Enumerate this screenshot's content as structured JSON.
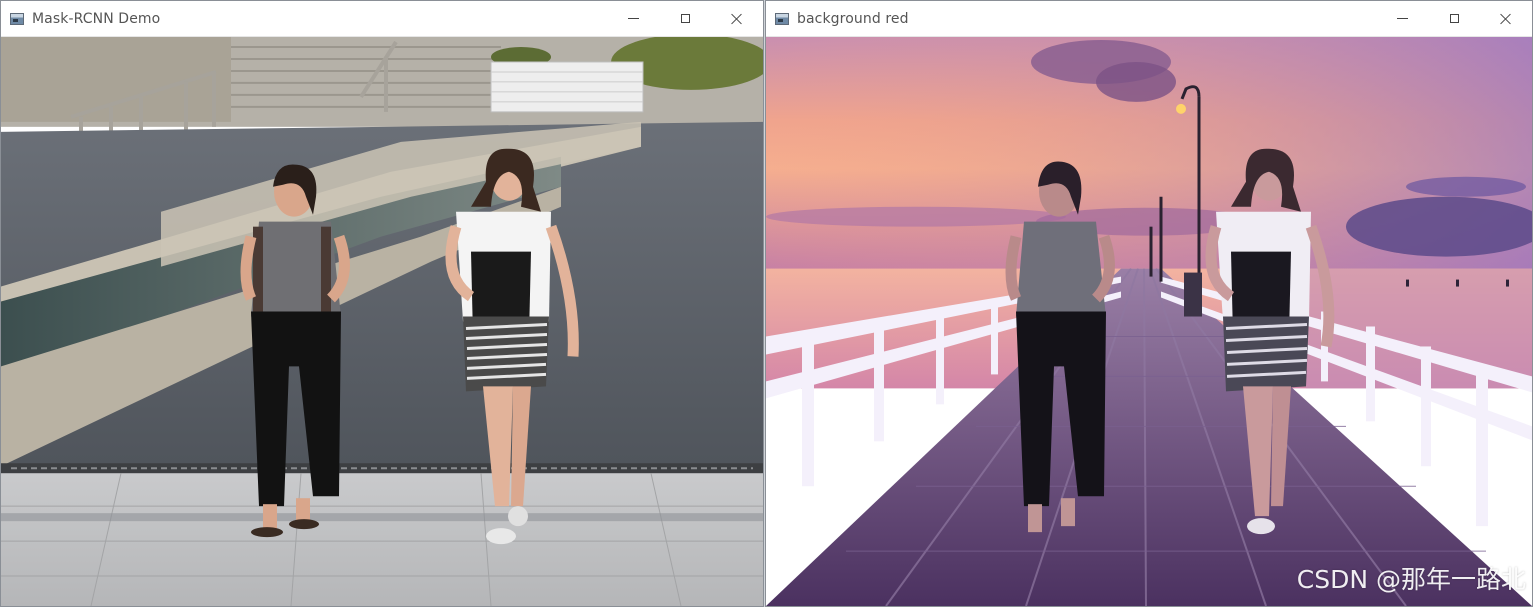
{
  "windows": [
    {
      "title": "Mask-RCNN Demo",
      "icon": "app-window-icon",
      "controls": [
        "minimize-icon",
        "maximize-icon",
        "close-icon"
      ],
      "image": "original street photo of two women walking"
    },
    {
      "title": "background red",
      "icon": "app-window-icon",
      "controls": [
        "minimize-icon",
        "maximize-icon",
        "close-icon"
      ],
      "image": "segmented women composited onto sunset pier background"
    }
  ],
  "watermark": "CSDN @那年一路北",
  "colors": {
    "titlebar_bg": "#ffffff",
    "title_text": "#555555",
    "sky_top": "#a47cc4",
    "sky_horizon": "#f2a58a",
    "pier": "#6b4a7a",
    "pavement": "#5e646c"
  }
}
